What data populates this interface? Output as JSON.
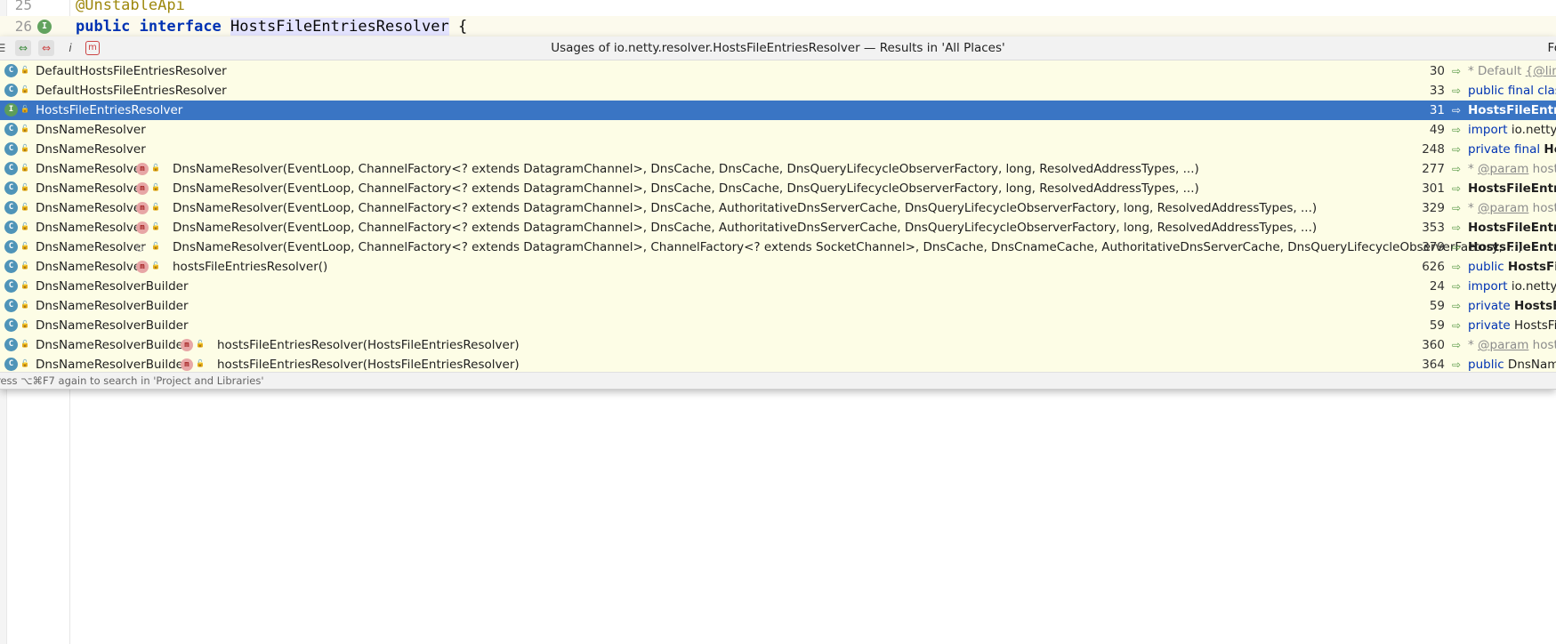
{
  "editor": {
    "lines": [
      {
        "number": "25",
        "text": "@UnstableApi"
      },
      {
        "number": "26",
        "keyword1": "public",
        "keyword2": "interface",
        "class_name": "HostsFileEntriesResolver",
        "brace": "{"
      }
    ],
    "gutter_icon": "I"
  },
  "popup": {
    "title": "Usages of io.netty.resolver.HostsFileEntriesResolver — Results in 'All Places'",
    "right_label": "Fo",
    "toolbar": {
      "b3": "i",
      "b4": "m"
    },
    "footer": "ress ⌥⌘F7 again to search in 'Project and Libraries'",
    "rows": [
      {
        "icon": "C",
        "class": "DefaultHostsFileEntriesResolver",
        "member": "",
        "line": "30",
        "preview": [
          {
            "t": "* Default ",
            "s": "doc"
          },
          {
            "t": "{@link",
            "s": "tag"
          }
        ]
      },
      {
        "icon": "C",
        "class": "DefaultHostsFileEntriesResolver",
        "member": "",
        "line": "33",
        "preview": [
          {
            "t": "public final clas",
            "s": "kw"
          }
        ]
      },
      {
        "icon": "I",
        "class": "HostsFileEntriesResolver",
        "member": "",
        "line": "31",
        "preview": [
          {
            "t": "HostsFileEntrie",
            "s": "bold"
          }
        ],
        "selected": true
      },
      {
        "icon": "C",
        "class": "DnsNameResolver",
        "member": "",
        "line": "49",
        "preview": [
          {
            "t": "import ",
            "s": "kw"
          },
          {
            "t": "io.netty.",
            "s": ""
          }
        ]
      },
      {
        "icon": "C",
        "class": "DnsNameResolver",
        "member": "",
        "line": "248",
        "preview": [
          {
            "t": "private final ",
            "s": "kw"
          },
          {
            "t": "Hos",
            "s": "bold"
          }
        ]
      },
      {
        "icon": "C",
        "class": "DnsNameResolver",
        "member": "DnsNameResolver(EventLoop, ChannelFactory<? extends DatagramChannel>, DnsCache, DnsCache, DnsQueryLifecycleObserverFactory, long, ResolvedAddressTypes, ...)",
        "member_icon": "m",
        "line": "277",
        "preview": [
          {
            "t": "* ",
            "s": "doc"
          },
          {
            "t": "@param",
            "s": "tag"
          },
          {
            "t": " hosts",
            "s": "doc"
          }
        ]
      },
      {
        "icon": "C",
        "class": "DnsNameResolver",
        "member": "DnsNameResolver(EventLoop, ChannelFactory<? extends DatagramChannel>, DnsCache, DnsCache, DnsQueryLifecycleObserverFactory, long, ResolvedAddressTypes, ...)",
        "member_icon": "m",
        "line": "301",
        "preview": [
          {
            "t": "HostsFileEntrie",
            "s": "bold"
          }
        ]
      },
      {
        "icon": "C",
        "class": "DnsNameResolver",
        "member": "DnsNameResolver(EventLoop, ChannelFactory<? extends DatagramChannel>, DnsCache, AuthoritativeDnsServerCache, DnsQueryLifecycleObserverFactory, long, ResolvedAddressTypes, ...)",
        "member_icon": "m",
        "line": "329",
        "preview": [
          {
            "t": "* ",
            "s": "doc"
          },
          {
            "t": "@param",
            "s": "tag"
          },
          {
            "t": " hosts",
            "s": "doc"
          }
        ]
      },
      {
        "icon": "C",
        "class": "DnsNameResolver",
        "member": "DnsNameResolver(EventLoop, ChannelFactory<? extends DatagramChannel>, DnsCache, AuthoritativeDnsServerCache, DnsQueryLifecycleObserverFactory, long, ResolvedAddressTypes, ...)",
        "member_icon": "m",
        "line": "353",
        "preview": [
          {
            "t": "HostsFileEntrie",
            "s": "bold"
          }
        ]
      },
      {
        "icon": "C",
        "class": "DnsNameResolver",
        "member": "DnsNameResolver(EventLoop, ChannelFactory<? extends DatagramChannel>, ChannelFactory<? extends SocketChannel>, DnsCache, DnsCnameCache, AuthoritativeDnsServerCache, DnsQueryLifecycleObserverFactory, ...)",
        "member_icon": "o",
        "line": "379",
        "preview": [
          {
            "t": "HostsFileEntrie",
            "s": "bold"
          }
        ]
      },
      {
        "icon": "C",
        "class": "DnsNameResolver",
        "member": "hostsFileEntriesResolver()",
        "member_icon": "m",
        "line": "626",
        "preview": [
          {
            "t": "public ",
            "s": "kw"
          },
          {
            "t": "HostsFile",
            "s": "bold"
          }
        ]
      },
      {
        "icon": "C",
        "class": "DnsNameResolverBuilder",
        "member": "",
        "line": "24",
        "preview": [
          {
            "t": "import ",
            "s": "kw"
          },
          {
            "t": "io.netty.",
            "s": ""
          }
        ]
      },
      {
        "icon": "C",
        "class": "DnsNameResolverBuilder",
        "member": "",
        "line": "59",
        "preview": [
          {
            "t": "private ",
            "s": "kw"
          },
          {
            "t": "HostsFil",
            "s": "bold"
          }
        ]
      },
      {
        "icon": "C",
        "class": "DnsNameResolverBuilder",
        "member": "",
        "line": "59",
        "preview": [
          {
            "t": "private ",
            "s": "kw"
          },
          {
            "t": "HostsFil",
            "s": ""
          }
        ]
      },
      {
        "icon": "C",
        "class": "DnsNameResolverBuilder",
        "member": "hostsFileEntriesResolver(HostsFileEntriesResolver)",
        "member_icon": "m",
        "line": "360",
        "preview": [
          {
            "t": "* ",
            "s": "doc"
          },
          {
            "t": "@param",
            "s": "tag"
          },
          {
            "t": " hosts",
            "s": "doc"
          }
        ]
      },
      {
        "icon": "C",
        "class": "DnsNameResolverBuilder",
        "member": "hostsFileEntriesResolver(HostsFileEntriesResolver)",
        "member_icon": "m",
        "line": "364",
        "preview": [
          {
            "t": "public ",
            "s": "kw"
          },
          {
            "t": "DnsName",
            "s": ""
          }
        ]
      }
    ]
  }
}
